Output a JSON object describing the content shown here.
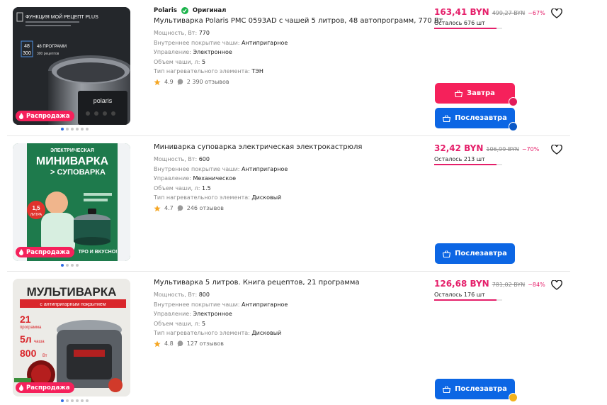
{
  "products": [
    {
      "brand": "Polaris",
      "brand_badge": "Оригинал",
      "title": "Мультиварка Polaris PMC 0593AD с чашей 5 литров, 48 автопрограмм, 770 Вт",
      "specs": [
        {
          "label": "Мощность, Вт:",
          "value": "770"
        },
        {
          "label": "Внутреннее покрытие чаши:",
          "value": "Антипригарное"
        },
        {
          "label": "Управление:",
          "value": "Электронное"
        },
        {
          "label": "Объем чаши, л:",
          "value": "5"
        },
        {
          "label": "Тип нагревательного элемента:",
          "value": "ТЭН"
        }
      ],
      "rating": "4.9",
      "reviews": "2 390 отзывов",
      "price": "163,41 BYN",
      "old_price": "499,27 BYN",
      "discount": "−67%",
      "stock_text": "Осталось 676 шт",
      "stock_fraction": 0.92,
      "sale_label": "Распродажа",
      "image_text": {
        "line1": "ФУНКЦИЯ МОЙ РЕЦЕПТ PLUS",
        "n1": "48",
        "n2": "300",
        "t1": "48 ПРОГРАММ",
        "t2": "300 рецептов",
        "brandmark": "polaris"
      },
      "buttons": [
        "Завтра",
        "Послезавтра"
      ]
    },
    {
      "title": "Миниварка суповарка электрическая электрокастрюля",
      "specs": [
        {
          "label": "Мощность, Вт:",
          "value": "600"
        },
        {
          "label": "Внутреннее покрытие чаши:",
          "value": "Антипригарное"
        },
        {
          "label": "Управление:",
          "value": "Механическое"
        },
        {
          "label": "Объем чаши, л:",
          "value": "1.5"
        },
        {
          "label": "Тип нагревательного элемента:",
          "value": "Дисковый"
        }
      ],
      "rating": "4.7",
      "reviews": "246 отзывов",
      "price": "32,42 BYN",
      "old_price": "106,99 BYN",
      "discount": "−70%",
      "stock_text": "Осталось 213 шт",
      "stock_fraction": 0.92,
      "sale_label": "Распродажа",
      "image_text": {
        "top": "ЭЛЕКТРИЧЕСКАЯ",
        "big": "МИНИВАРКА",
        "sub": "> СУПОВАРКА",
        "vol": "1,5",
        "vol_unit": "ЛИТРА",
        "bottom": "ТРО И ВКУСНО!"
      },
      "buttons": [
        "Послезавтра"
      ]
    },
    {
      "title": "Мультиварка 5 литров. Книга рецептов, 21 программа",
      "specs": [
        {
          "label": "Мощность, Вт:",
          "value": "800"
        },
        {
          "label": "Внутреннее покрытие чаши:",
          "value": "Антипригарное"
        },
        {
          "label": "Управление:",
          "value": "Электронное"
        },
        {
          "label": "Объем чаши, л:",
          "value": "5"
        },
        {
          "label": "Тип нагревательного элемента:",
          "value": "Дисковый"
        }
      ],
      "rating": "4.8",
      "reviews": "127 отзывов",
      "price": "126,68 BYN",
      "old_price": "781,02 BYN",
      "discount": "−84%",
      "stock_text": "Осталось 176 шт",
      "stock_fraction": 0.92,
      "sale_label": "Распродажа",
      "image_text": {
        "big": "МУЛЬТИВАРКА",
        "ribbon": "с антипригарным покрытием",
        "p1": "21",
        "p1u": "программа",
        "p2": "5л",
        "p2u": "чаша",
        "p3": "800",
        "p3u": "Вт"
      },
      "buttons": [
        "Послезавтра"
      ]
    }
  ],
  "colors": {
    "accent_pink": "#f5215b",
    "accent_blue": "#0c66e4",
    "price": "#e51f6a",
    "verified": "#1bb34b"
  }
}
